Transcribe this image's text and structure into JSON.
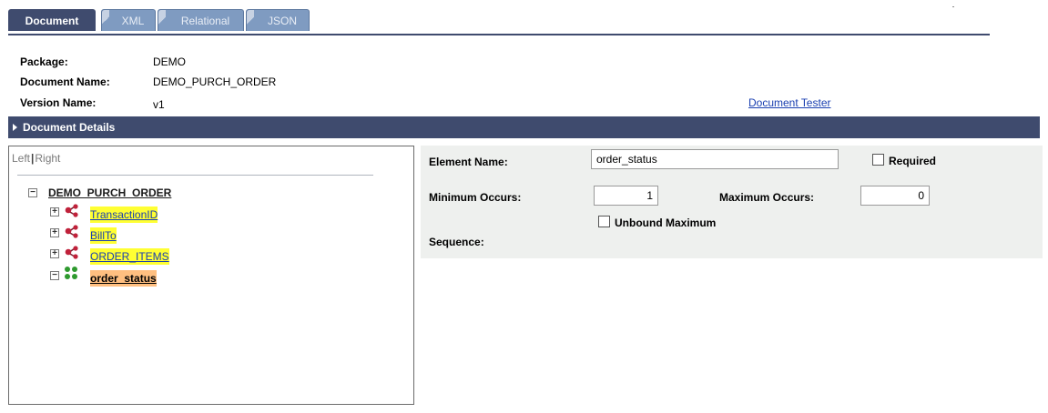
{
  "tabs": [
    {
      "label": "Document",
      "active": true
    },
    {
      "label": "XML",
      "active": false
    },
    {
      "label": "Relational",
      "active": false
    },
    {
      "label": "JSON",
      "active": false
    }
  ],
  "header": {
    "package_label": "Package:",
    "package_value": "DEMO",
    "document_name_label": "Document Name:",
    "document_name_value": "DEMO_PURCH_ORDER",
    "version_name_label": "Version Name:",
    "version_name_value": "v1",
    "document_tester_link": "Document Tester"
  },
  "section": {
    "title": "Document Details",
    "expanded": false
  },
  "tree": {
    "left_label": "Left",
    "separator": "|",
    "right_label": "Right",
    "root": {
      "label": "DEMO_PURCH_ORDER",
      "expanded": true
    },
    "nodes": [
      {
        "label": "TransactionID",
        "icon": "compound-element-icon",
        "expanded": false,
        "highlight": "yellow"
      },
      {
        "label": "BillTo",
        "icon": "compound-element-icon",
        "expanded": false,
        "highlight": "yellow"
      },
      {
        "label": "ORDER_ITEMS",
        "icon": "compound-element-icon",
        "expanded": false,
        "highlight": "yellow"
      },
      {
        "label": "order_status",
        "icon": "sequence-element-icon",
        "expanded": true,
        "highlight": "orange",
        "selected": true
      }
    ]
  },
  "properties": {
    "element_name_label": "Element Name:",
    "element_name_value": "order_status",
    "required_label": "Required",
    "required_checked": false,
    "min_occurs_label": "Minimum Occurs:",
    "min_occurs_value": "1",
    "max_occurs_label": "Maximum Occurs:",
    "max_occurs_value": "0",
    "unbound_max_label": "Unbound Maximum",
    "unbound_max_checked": false,
    "sequence_label": "Sequence:"
  },
  "colors": {
    "tab_active": "#3f4b6e",
    "tab_inactive": "#7f9bc1",
    "section_bar": "#3f4b6e",
    "link": "#1a3fb0",
    "highlight_yellow": "#ffff33",
    "highlight_orange": "#ffbf80",
    "panel_bg": "#eef0ee"
  }
}
